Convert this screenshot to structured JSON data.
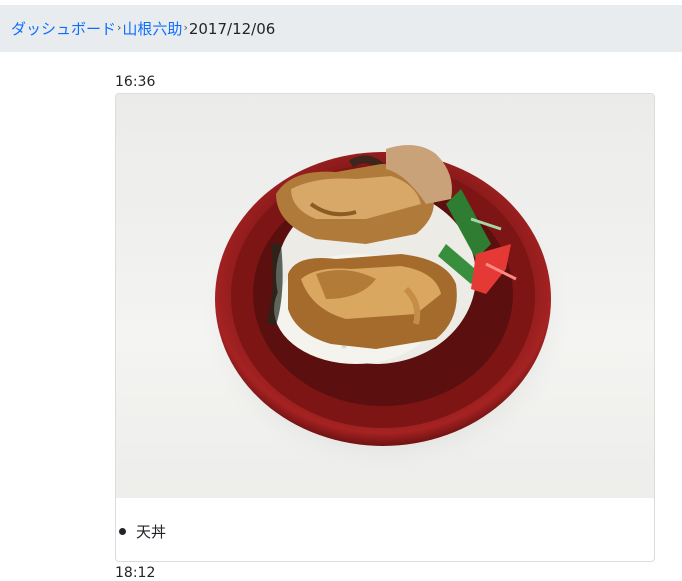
{
  "breadcrumb": {
    "items": [
      "ダッシュボード",
      "山根六助"
    ],
    "separator": "›",
    "current": "2017/12/06"
  },
  "entries": [
    {
      "time": "16:36",
      "image_alt": "天丼",
      "foods": [
        "天丼"
      ]
    },
    {
      "time": "18:12"
    }
  ],
  "colors": {
    "link": "#0d6efd",
    "breadcrumb_bg": "#e9ecef"
  }
}
